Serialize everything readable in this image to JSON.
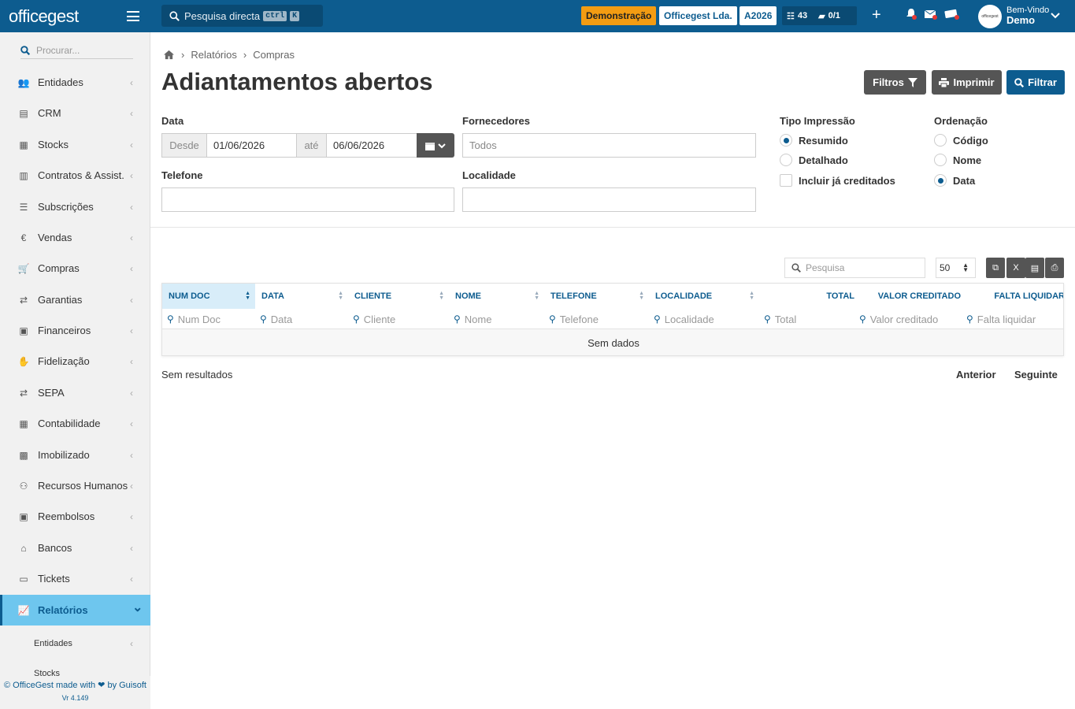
{
  "topbar": {
    "logo": "officegest",
    "search_placeholder": "Pesquisa directa",
    "kbd1": "ctrl",
    "kbd2": "K",
    "demo_badge": "Demonstração",
    "company": "Officegest Lda.",
    "year": "A2026",
    "tasks_count": "43",
    "docs_count": "0/1",
    "welcome": "Bem-Vindo",
    "user": "Demo",
    "avatar_text": "officegest"
  },
  "sidebar": {
    "search_placeholder": "Procurar...",
    "items": [
      {
        "label": "Entidades",
        "icon": "users-icon"
      },
      {
        "label": "CRM",
        "icon": "book-icon"
      },
      {
        "label": "Stocks",
        "icon": "warehouse-icon"
      },
      {
        "label": "Contratos & Assist.",
        "icon": "file-contract-icon"
      },
      {
        "label": "Subscrições",
        "icon": "list-icon"
      },
      {
        "label": "Vendas",
        "icon": "euro-icon"
      },
      {
        "label": "Compras",
        "icon": "cart-icon"
      },
      {
        "label": "Garantias",
        "icon": "exchange-icon"
      },
      {
        "label": "Financeiros",
        "icon": "money-icon"
      },
      {
        "label": "Fidelização",
        "icon": "hand-holding-icon"
      },
      {
        "label": "SEPA",
        "icon": "exchange-icon"
      },
      {
        "label": "Contabilidade",
        "icon": "calculator-icon"
      },
      {
        "label": "Imobilizado",
        "icon": "box-icon"
      },
      {
        "label": "Recursos Humanos",
        "icon": "sitemap-icon"
      },
      {
        "label": "Reembolsos",
        "icon": "money-icon"
      },
      {
        "label": "Bancos",
        "icon": "bank-icon"
      },
      {
        "label": "Tickets",
        "icon": "ticket-icon"
      },
      {
        "label": "Relatórios",
        "icon": "chart-line-icon"
      }
    ],
    "sub_items": [
      "Entidades",
      "Stocks"
    ],
    "footer": "© OfficeGest made with ❤ by Guisoft",
    "version": "Vr 4.149"
  },
  "breadcrumb": [
    "Relatórios",
    "Compras"
  ],
  "page_title": "Adiantamentos abertos",
  "buttons": {
    "filters": "Filtros",
    "print": "Imprimir",
    "filter": "Filtrar"
  },
  "form": {
    "data_label": "Data",
    "from_label": "Desde",
    "from_value": "01/06/2026",
    "to_label": "até",
    "to_value": "06/06/2026",
    "suppliers_label": "Fornecedores",
    "suppliers_placeholder": "Todos",
    "phone_label": "Telefone",
    "locality_label": "Localidade",
    "print_type_label": "Tipo Impressão",
    "print_type_options": [
      "Resumido",
      "Detalhado"
    ],
    "print_type_selected": "Resumido",
    "include_credited": "Incluir já creditados",
    "order_label": "Ordenação",
    "order_options": [
      "Código",
      "Nome",
      "Data"
    ],
    "order_selected": "Data"
  },
  "table": {
    "search_placeholder": "Pesquisa",
    "page_size": "50",
    "columns": [
      "NUM DOC",
      "DATA",
      "CLIENTE",
      "NOME",
      "TELEFONE",
      "LOCALIDADE",
      "TOTAL",
      "VALOR CREDITADO",
      "FALTA LIQUIDAR"
    ],
    "filters": [
      "Num Doc",
      "Data",
      "Cliente",
      "Nome",
      "Telefone",
      "Localidade",
      "Total",
      "Valor creditado",
      "Falta liquidar"
    ],
    "empty": "Sem dados",
    "results": "Sem resultados",
    "prev": "Anterior",
    "next": "Seguinte"
  },
  "colors": {
    "brand": "#0d5c8f",
    "accent": "#f39c12",
    "active_bg": "#6ec6ee"
  }
}
